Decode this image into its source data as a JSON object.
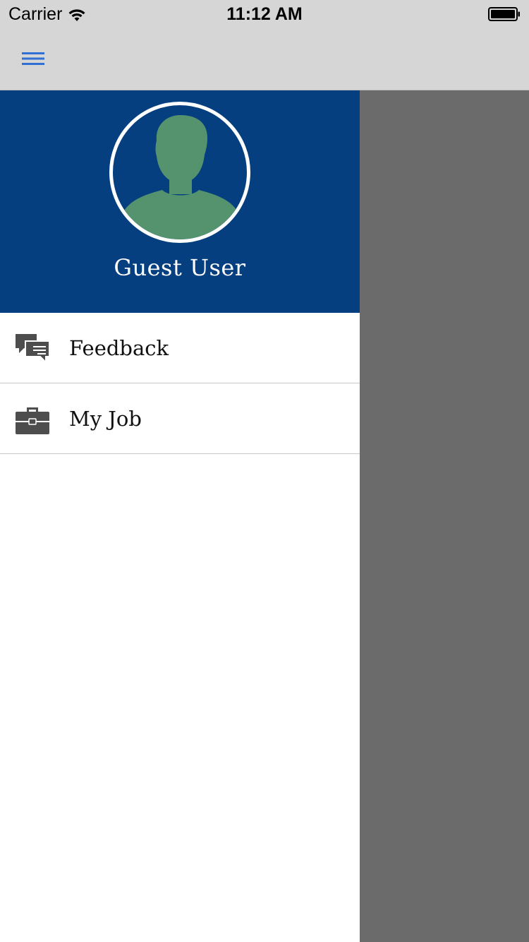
{
  "status_bar": {
    "carrier": "Carrier",
    "time": "11:12 AM",
    "wifi_icon": "wifi-icon",
    "battery_icon": "battery-icon"
  },
  "nav": {
    "menu_icon": "hamburger-menu-icon",
    "accent_color": "#2f6fd6"
  },
  "drawer": {
    "header_color": "#063f80",
    "avatar_icon": "user-silhouette-icon",
    "avatar_color": "#55936f",
    "user_name": "Guest User",
    "items": [
      {
        "label": "Feedback",
        "icon": "chat-bubbles-icon"
      },
      {
        "label": "My Job",
        "icon": "briefcase-icon"
      }
    ]
  },
  "overlay_color": "#6b6b6b"
}
